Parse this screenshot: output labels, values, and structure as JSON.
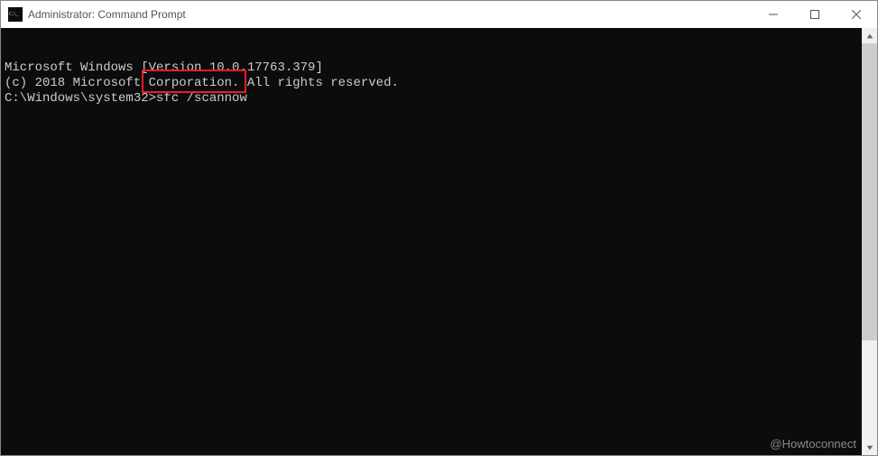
{
  "window": {
    "title": "Administrator: Command Prompt"
  },
  "terminal": {
    "line1": "Microsoft Windows [Version 10.0.17763.379]",
    "line2": "(c) 2018 Microsoft Corporation. All rights reserved.",
    "blank": "",
    "prompt": "C:\\Windows\\system32>",
    "command": "sfc /scannow"
  },
  "watermark": "@Howtoconnect"
}
